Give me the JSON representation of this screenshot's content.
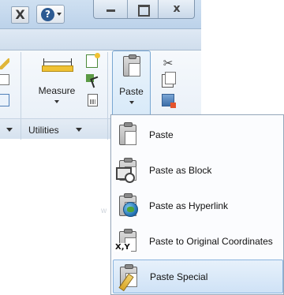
{
  "window": {
    "app_button_glyph": "X",
    "help_glyph": "?",
    "close_glyph": "x"
  },
  "ribbon": {
    "measure_label": "Measure",
    "paste_label": "Paste",
    "utilities_panel": "Utilities"
  },
  "paste_menu": {
    "items": [
      {
        "label": "Paste",
        "icon": "paste-icon"
      },
      {
        "label": "Paste as Block",
        "icon": "paste-as-block-icon"
      },
      {
        "label": "Paste as Hyperlink",
        "icon": "paste-as-hyperlink-icon"
      },
      {
        "label": "Paste to Original Coordinates",
        "icon": "paste-to-original-coordinates-icon",
        "badge": "X,Y"
      },
      {
        "label": "Paste Special",
        "icon": "paste-special-icon",
        "highlighted": true
      }
    ]
  }
}
